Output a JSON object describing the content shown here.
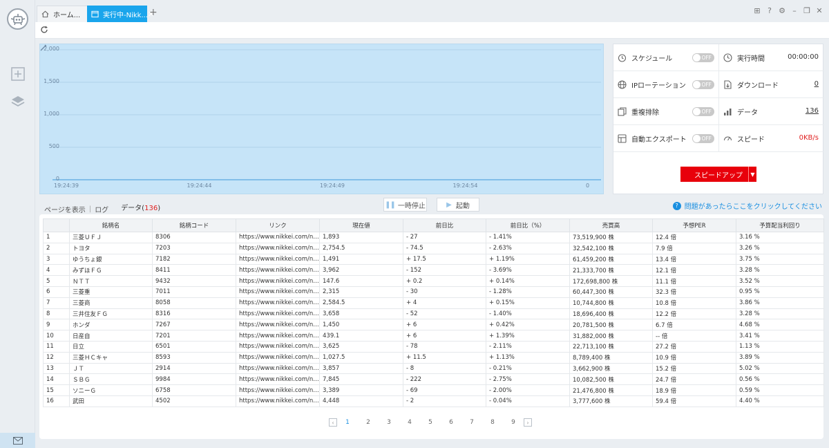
{
  "tabs": {
    "home": "ホーム...",
    "running": "実行中-Nikk..."
  },
  "chart_data": {
    "type": "line",
    "x": [
      "19:24:39",
      "19:24:44",
      "19:24:49",
      "19:24:54",
      "0"
    ],
    "y_ticks": [
      "2,000",
      "1,500",
      "1,000",
      "500",
      "0"
    ],
    "ylim": [
      0,
      2000
    ],
    "series": [
      {
        "values": [
          0,
          0,
          0,
          0,
          0
        ]
      }
    ],
    "grid": true
  },
  "panel": {
    "schedule_label": "スケジュール",
    "schedule_state": "OFF",
    "runtime_label": "実行時間",
    "runtime_value": "00:00:00",
    "ip_label": "IPローテーション",
    "ip_state": "OFF",
    "download_label": "ダウンロード",
    "download_value": "0",
    "dedupe_label": "重複排除",
    "dedupe_state": "OFF",
    "data_label": "データ",
    "data_value": "136",
    "export_label": "自動エクスポート",
    "export_state": "OFF",
    "speed_label": "スピード",
    "speed_value": "0KB/s",
    "speedup_button": "スピードアップ"
  },
  "subtabs": {
    "page": "ページを表示",
    "log": "ログ",
    "data": "データ(",
    "data_count": "136",
    "data_close": ")"
  },
  "controls": {
    "pause": "一時停止",
    "start": "起動",
    "help": "問題があったらここをクリックしてください"
  },
  "table": {
    "headers": [
      "",
      "銘柄名",
      "銘柄コード",
      "リンク",
      "現在値",
      "前日比",
      "前日比（%）",
      "売買高",
      "予想PER",
      "予算配当利回り"
    ],
    "rows": [
      [
        "1",
        "三菱ＵＦＪ",
        "8306",
        "https://www.nikkei.com/nkd/com...",
        "1,893",
        "- 27",
        "- 1.41%",
        "73,519,900 株",
        "12.4 倍",
        "3.16 %"
      ],
      [
        "2",
        "トヨタ",
        "7203",
        "https://www.nikkei.com/nkd/com...",
        "2,754.5",
        "- 74.5",
        "- 2.63%",
        "32,542,100 株",
        "7.9 倍",
        "3.26 %"
      ],
      [
        "3",
        "ゆうちょ銀",
        "7182",
        "https://www.nikkei.com/nkd/com...",
        "1,491",
        "+ 17.5",
        "+ 1.19%",
        "61,459,200 株",
        "13.4 倍",
        "3.75 %"
      ],
      [
        "4",
        "みずほＦＧ",
        "8411",
        "https://www.nikkei.com/nkd/com...",
        "3,962",
        "- 152",
        "- 3.69%",
        "21,333,700 株",
        "12.1 倍",
        "3.28 %"
      ],
      [
        "5",
        "ＮＴＴ",
        "9432",
        "https://www.nikkei.com/nkd/com...",
        "147.6",
        "+ 0.2",
        "+ 0.14%",
        "172,698,800 株",
        "11.1 倍",
        "3.52 %"
      ],
      [
        "6",
        "三菱重",
        "7011",
        "https://www.nikkei.com/nkd/com...",
        "2,315",
        "- 30",
        "- 1.28%",
        "60,447,300 株",
        "32.3 倍",
        "0.95 %"
      ],
      [
        "7",
        "三菱商",
        "8058",
        "https://www.nikkei.com/nkd/com...",
        "2,584.5",
        "+ 4",
        "+ 0.15%",
        "10,744,800 株",
        "10.8 倍",
        "3.86 %"
      ],
      [
        "8",
        "三井住友ＦＧ",
        "8316",
        "https://www.nikkei.com/nkd/com...",
        "3,658",
        "- 52",
        "- 1.40%",
        "18,696,400 株",
        "12.2 倍",
        "3.28 %"
      ],
      [
        "9",
        "ホンダ",
        "7267",
        "https://www.nikkei.com/nkd/com...",
        "1,450",
        "+ 6",
        "+ 0.42%",
        "20,781,500 株",
        "6.7 倍",
        "4.68 %"
      ],
      [
        "10",
        "日産自",
        "7201",
        "https://www.nikkei.com/nkd/com...",
        "439.1",
        "+ 6",
        "+ 1.39%",
        "31,882,000 株",
        "-- 倍",
        "3.41 %"
      ],
      [
        "11",
        "日立",
        "6501",
        "https://www.nikkei.com/nkd/com...",
        "3,625",
        "- 78",
        "- 2.11%",
        "22,713,100 株",
        "27.2 倍",
        "1.13 %"
      ],
      [
        "12",
        "三菱ＨＣキャ",
        "8593",
        "https://www.nikkei.com/nkd/com...",
        "1,027.5",
        "+ 11.5",
        "+ 1.13%",
        "8,789,400 株",
        "10.9 倍",
        "3.89 %"
      ],
      [
        "13",
        "ＪＴ",
        "2914",
        "https://www.nikkei.com/nkd/com...",
        "3,857",
        "- 8",
        "- 0.21%",
        "3,662,900 株",
        "15.2 倍",
        "5.02 %"
      ],
      [
        "14",
        "ＳＢＧ",
        "9984",
        "https://www.nikkei.com/nkd/com...",
        "7,845",
        "- 222",
        "- 2.75%",
        "10,082,500 株",
        "24.7 倍",
        "0.56 %"
      ],
      [
        "15",
        "ソニーＧ",
        "6758",
        "https://www.nikkei.com/nkd/com...",
        "3,389",
        "- 69",
        "- 2.00%",
        "21,476,800 株",
        "18.9 倍",
        "0.59 %"
      ],
      [
        "16",
        "武田",
        "4502",
        "https://www.nikkei.com/nkd/com...",
        "4,448",
        "- 2",
        "- 0.04%",
        "3,777,600 株",
        "59.4 倍",
        "4.40 %"
      ]
    ]
  },
  "pagination": {
    "pages": [
      "1",
      "2",
      "3",
      "4",
      "5",
      "6",
      "7",
      "8",
      "9"
    ],
    "current": "1"
  },
  "colors": {
    "accent": "#1aa5ec",
    "chart_fill": "#c6e4f8",
    "danger": "#e8000b",
    "link": "#1a8fe0"
  }
}
